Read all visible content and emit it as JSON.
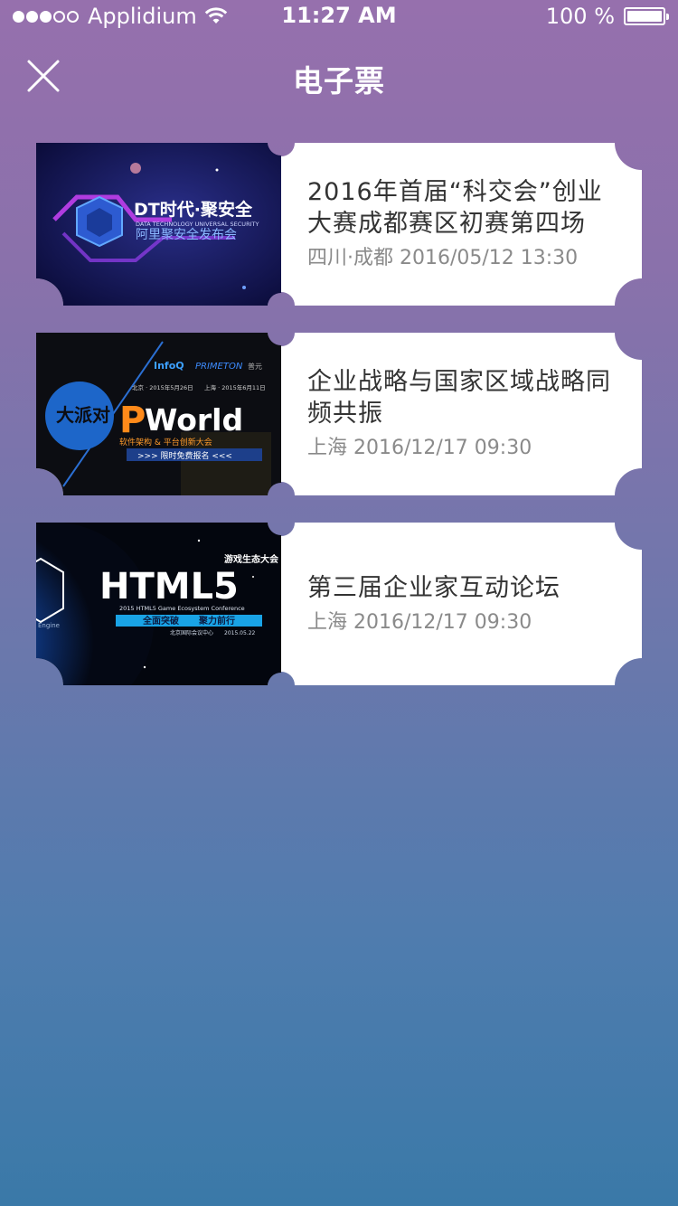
{
  "status_bar": {
    "carrier": "Applidium",
    "time": "11:27 AM",
    "battery": "100 %",
    "signal_bars_filled": 3,
    "signal_bars_total": 5
  },
  "nav": {
    "title": "电子票",
    "close_icon": "close-icon"
  },
  "tickets": [
    {
      "title": "2016年首届“科交会”创业大赛成都赛区初赛第四场",
      "meta": "四川·成都 2016/05/12 13:30",
      "poster": {
        "headline": "DT时代·聚安全",
        "subline": "DATA TECHNOLOGY UNIVERSAL SECURITY",
        "tagline": "阿里聚安全发布会"
      }
    },
    {
      "title": "企业战略与国家区域战略同频共振",
      "meta": "上海 2016/12/17 09:30",
      "poster": {
        "brand_a": "InfoQ",
        "brand_b": "PRIMETON",
        "brand_c": "普元",
        "date_a": "北京 · 2015年5月26日",
        "date_b": "上海 · 2015年6月11日",
        "logo_letter": "P",
        "headline": "World",
        "subline": "软件架构 & 平台创新大会",
        "banner": ">>> 限时免费报名 <<<",
        "badge": "大派对"
      }
    },
    {
      "title": "第三届企业家互动论坛",
      "meta": "上海 2016/12/17 09:30",
      "poster": {
        "kicker": "游戏生态大会",
        "headline": "HTML5",
        "subline": "2015 HTML5 Game Ecosystem Conference",
        "banner_a": "全面突破",
        "banner_b": "聚力前行",
        "venue": "北京国际会议中心",
        "date": "2015.05.22",
        "side_text": "Engine"
      }
    }
  ],
  "colors": {
    "gradient_top": "#9670ad",
    "gradient_bottom": "#3a79a8",
    "title_text": "#333333",
    "meta_text": "#8a8a8a"
  }
}
